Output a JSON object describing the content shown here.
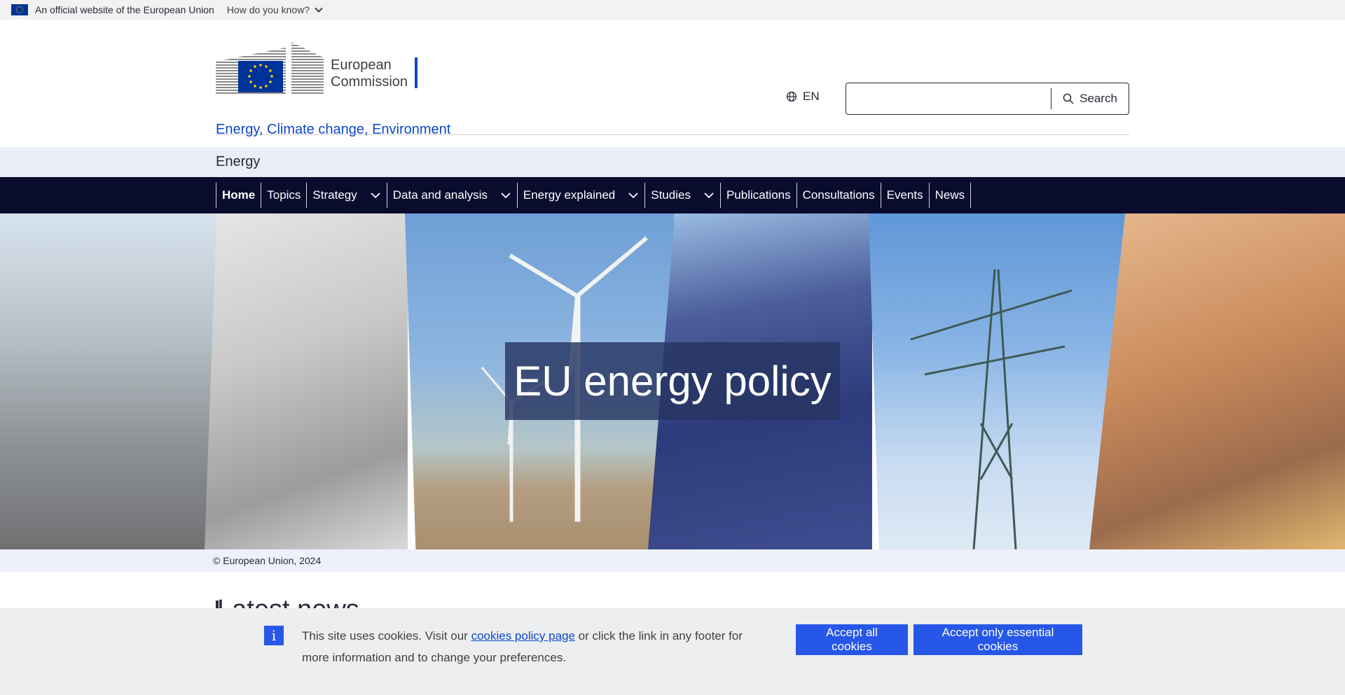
{
  "eu_bar": {
    "official_text": "An official website of the European Union",
    "how_know_text": "How do you know?"
  },
  "header": {
    "logo_line1": "European",
    "logo_line2": "Commission",
    "language": "EN",
    "search": {
      "value": "",
      "button_label": "Search"
    }
  },
  "site_name": "Energy, Climate change, Environment",
  "section_band_title": "Energy",
  "nav": {
    "items": [
      {
        "label": "Home"
      },
      {
        "label": "Topics"
      },
      {
        "label": "Strategy"
      },
      {
        "label": "Data and analysis"
      },
      {
        "label": "Energy explained"
      },
      {
        "label": "Studies"
      },
      {
        "label": "Publications"
      },
      {
        "label": "Consultations"
      },
      {
        "label": "Events"
      },
      {
        "label": "News"
      }
    ]
  },
  "hero": {
    "title": "EU energy policy",
    "caption": "© European Union, 2024"
  },
  "main": {
    "section_title": "Latest news"
  },
  "cookie": {
    "text_before": "This site uses cookies. Visit our ",
    "link_text": "cookies policy page",
    "text_after": " or click the link in any footer for more information and to change your preferences.",
    "accept_all_label": "Accept all cookies",
    "accept_essential_label": "Accept only essential cookies"
  },
  "colors": {
    "primary_blue": "#0e47cb",
    "nav_background": "#0a0c2e",
    "button_blue": "#2757e8",
    "band_background": "#e9eef9"
  },
  "icons": [
    "eu-flag-icon",
    "chevron-down-icon",
    "globe-icon",
    "search-icon",
    "info-icon"
  ]
}
